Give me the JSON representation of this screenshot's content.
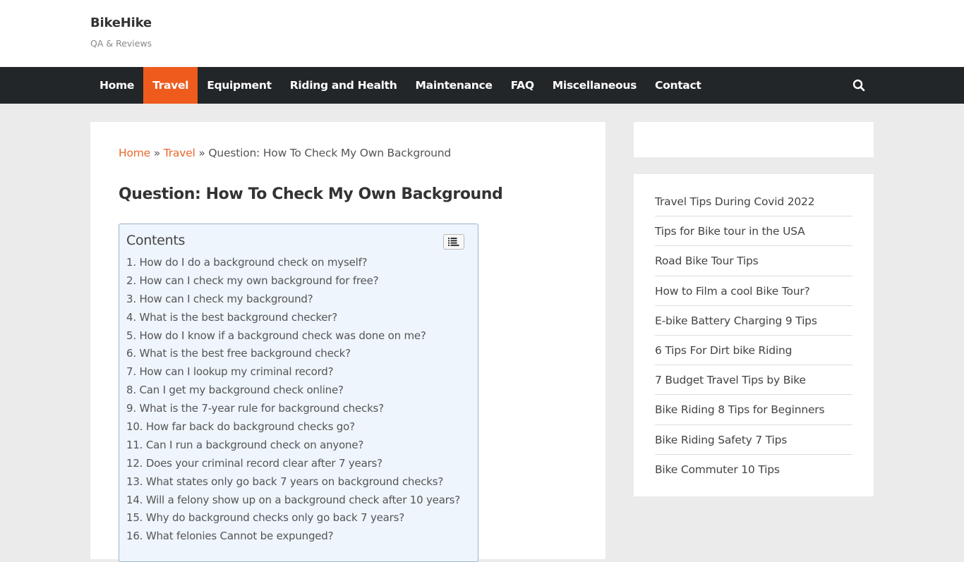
{
  "site": {
    "title": "BikeHike",
    "tagline": "QA & Reviews"
  },
  "nav": {
    "items": [
      {
        "label": "Home",
        "active": false
      },
      {
        "label": "Travel",
        "active": true
      },
      {
        "label": "Equipment",
        "active": false
      },
      {
        "label": "Riding and Health",
        "active": false
      },
      {
        "label": "Maintenance",
        "active": false
      },
      {
        "label": "FAQ",
        "active": false
      },
      {
        "label": "Miscellaneous",
        "active": false
      },
      {
        "label": "Contact",
        "active": false
      }
    ],
    "search_icon": "search-icon",
    "active_color": "#ee5b1d",
    "bar_color": "#222629"
  },
  "breadcrumb": {
    "home": "Home",
    "sep1": " » ",
    "travel": "Travel",
    "sep2": " » ",
    "current": "Question: How To Check My Own Background"
  },
  "article": {
    "title": "Question: How To Check My Own Background"
  },
  "toc": {
    "title": "Contents",
    "toggle_icon": "list-toggle-icon",
    "items": [
      "1. How do I do a background check on myself?",
      "2. How can I check my own background for free?",
      "3. How can I check my background?",
      "4. What is the best background checker?",
      "5. How do I know if a background check was done on me?",
      "6. What is the best free background check?",
      "7. How can I lookup my criminal record?",
      "8. Can I get my background check online?",
      "9. What is the 7-year rule for background checks?",
      "10. How far back do background checks go?",
      "11. Can I run a background check on anyone?",
      "12. Does your criminal record clear after 7 years?",
      "13. What states only go back 7 years on background checks?",
      "14. Will a felony show up on a background check after 10 years?",
      "15. Why do background checks only go back 7 years?",
      "16. What felonies Cannot be expunged?"
    ]
  },
  "sidebar": {
    "posts": [
      "Travel Tips During Covid 2022",
      "Tips for Bike tour in the USA",
      "Road Bike Tour Tips",
      "How to Film a cool Bike Tour?",
      "E-bike Battery Charging 9 Tips",
      "6 Tips For Dirt bike Riding",
      "7 Budget Travel Tips by Bike",
      "Bike Riding 8 Tips for Beginners",
      "Bike Riding Safety 7 Tips",
      "Bike Commuter 10 Tips"
    ]
  }
}
